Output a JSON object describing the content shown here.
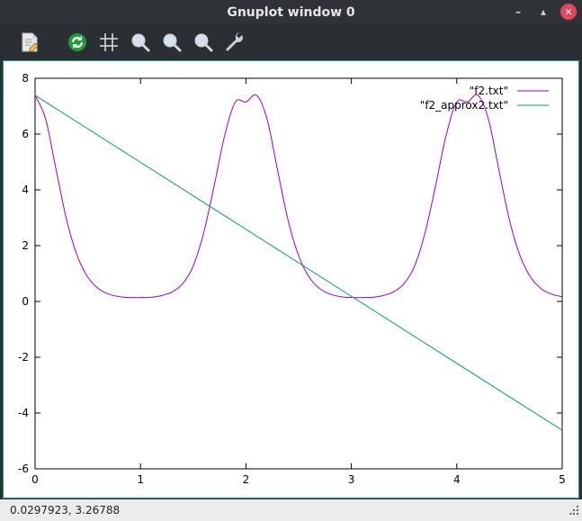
{
  "window": {
    "title": "Gnuplot window 0"
  },
  "toolbar": {
    "buttons": [
      {
        "icon": "export-icon",
        "label": "Export"
      },
      {
        "icon": "replot-icon",
        "label": "Replot"
      },
      {
        "icon": "grid-icon",
        "label": "Show grid"
      },
      {
        "icon": "zoom-previous-icon",
        "label": "Previous zoom"
      },
      {
        "icon": "zoom-next-icon",
        "label": "Next zoom"
      },
      {
        "icon": "autoscale-icon",
        "label": "Autoscale"
      },
      {
        "icon": "settings-icon",
        "label": "Settings"
      }
    ]
  },
  "status": {
    "coordinates": "0.0297923,  3.26788"
  },
  "colors": {
    "series1": "#9400d3",
    "series2": "#009e73",
    "frame": "#16a085"
  },
  "chart_data": {
    "type": "line",
    "title": "",
    "xlabel": "",
    "ylabel": "",
    "xlim": [
      0,
      5
    ],
    "ylim": [
      -6,
      8
    ],
    "xticks": [
      "0",
      "1",
      "2",
      "3",
      "4",
      "5"
    ],
    "yticks": [
      "-6",
      "-4",
      "-2",
      "0",
      "2",
      "4",
      "6",
      "8"
    ],
    "grid": false,
    "legend_position": "top-right",
    "series": [
      {
        "name": "\"f2.txt\"",
        "color": "#9400d3",
        "x": [
          0,
          0.1,
          0.2,
          0.3,
          0.4,
          0.5,
          0.6,
          0.7,
          0.8,
          0.9,
          1.0,
          1.1,
          1.2,
          1.3,
          1.4,
          1.5,
          1.6,
          1.7,
          1.8,
          1.9,
          2.0,
          2.1,
          2.2,
          2.3,
          2.4,
          2.5,
          2.6,
          2.7,
          2.8,
          2.9,
          3.0,
          3.1,
          3.2,
          3.3,
          3.4,
          3.5,
          3.6,
          3.7,
          3.8,
          3.9,
          4.0,
          4.1,
          4.2,
          4.3,
          4.4,
          4.5,
          4.6,
          4.7,
          4.8,
          4.9,
          5.0
        ],
        "y": [
          7.39,
          6.54,
          4.71,
          2.91,
          1.64,
          0.87,
          0.46,
          0.26,
          0.17,
          0.14,
          0.14,
          0.15,
          0.21,
          0.34,
          0.64,
          1.27,
          2.47,
          4.17,
          5.97,
          7.15,
          7.15,
          7.39,
          6.54,
          4.71,
          2.91,
          1.64,
          0.87,
          0.46,
          0.26,
          0.17,
          0.14,
          0.14,
          0.15,
          0.21,
          0.34,
          0.64,
          1.27,
          2.47,
          4.17,
          5.97,
          7.15,
          7.15,
          7.39,
          6.54,
          4.71,
          2.91,
          1.64,
          0.87,
          0.46,
          0.26,
          0.17
        ]
      },
      {
        "name": "\"f2_approx2.txt\"",
        "color": "#009e73",
        "x": [
          0,
          5
        ],
        "y": [
          7.39,
          -4.62
        ]
      }
    ]
  }
}
